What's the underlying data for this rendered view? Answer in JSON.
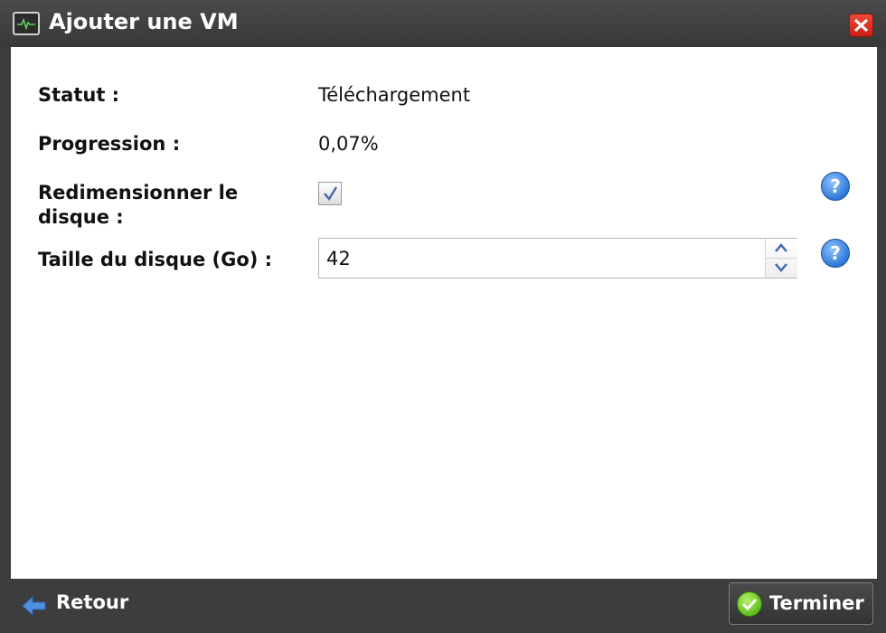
{
  "window": {
    "title": "Ajouter une VM"
  },
  "form": {
    "status_label": "Statut :",
    "status_value": "Téléchargement",
    "progress_label": "Progression :",
    "progress_value": "0,07%",
    "resize_label_line1": "Redimensionner le",
    "resize_label_line2": "disque :",
    "resize_checked": true,
    "disk_size_label": "Taille du disque (Go) :",
    "disk_size_value": "42",
    "help_glyph": "?"
  },
  "footer": {
    "back_label": "Retour",
    "finish_label": "Terminer"
  },
  "icons": {
    "title": "vm-monitor-icon",
    "close": "close-icon",
    "help": "help-icon",
    "back": "arrow-left-icon",
    "finish": "check-circle-icon"
  },
  "colors": {
    "chrome": "#3d3d3d",
    "help_blue": "#2f78d8",
    "finish_green": "#5fbf1d",
    "close_red": "#d8281c"
  }
}
